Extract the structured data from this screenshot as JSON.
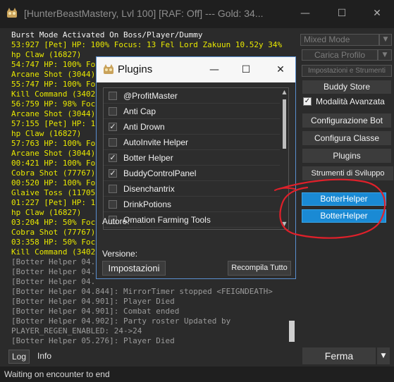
{
  "window": {
    "title": "[HunterBeastMastery, Lvl 100] [RAF: Off] --- Gold: 34...",
    "minimize": "—",
    "maximize": "☐",
    "close": "✕"
  },
  "console": {
    "lines": [
      {
        "text": "Burst Mode Activated On Boss/Player/Dummy",
        "cls": "w"
      },
      {
        "text": "53:927 [Pet] HP: 100% Focus: 13 Fel Lord Zakuun 10.52y 34%",
        "cls": "y"
      },
      {
        "text": "hp Claw (16827)",
        "cls": "y"
      },
      {
        "text": "54:747 HP: 100% Fo",
        "cls": "y"
      },
      {
        "text": "Arcane Shot (3044)",
        "cls": "y"
      },
      {
        "text": "55:747 HP: 100% Fo",
        "cls": "y"
      },
      {
        "text": "Kill Command (3402",
        "cls": "y"
      },
      {
        "text": "56:759 HP: 98% Foc",
        "cls": "y"
      },
      {
        "text": "Arcane Shot (3044)",
        "cls": "y"
      },
      {
        "text": "57:155 [Pet] HP: 1",
        "cls": "y"
      },
      {
        "text": "hp Claw (16827)",
        "cls": "y"
      },
      {
        "text": "57:763 HP: 100% Fo",
        "cls": "y"
      },
      {
        "text": "Arcane Shot (3044)",
        "cls": "y"
      },
      {
        "text": "00:421 HP: 100% Fo",
        "cls": "y"
      },
      {
        "text": "Cobra Shot (77767)",
        "cls": "y"
      },
      {
        "text": "00:520 HP: 100% Fo",
        "cls": "y"
      },
      {
        "text": "Glaive Toss (11705",
        "cls": "y"
      },
      {
        "text": "01:227 [Pet] HP: 1",
        "cls": "y"
      },
      {
        "text": "hp Claw (16827)",
        "cls": "y"
      },
      {
        "text": "03:204 HP: 50% Foc",
        "cls": "y"
      },
      {
        "text": "Cobra Shot (77767)",
        "cls": "y"
      },
      {
        "text": "03:358 HP: 50% Foc",
        "cls": "y"
      },
      {
        "text": "Kill Command (3402",
        "cls": "y"
      },
      {
        "text": "[Botter Helper 04.",
        "cls": "g"
      },
      {
        "text": "[Botter Helper 04.",
        "cls": "g"
      },
      {
        "text": "[Botter Helper 04.",
        "cls": "g"
      },
      {
        "text": "[Botter Helper 04.844]: MirrorTimer stopped <FEIGNDEATH>",
        "cls": "g"
      },
      {
        "text": "[Botter Helper 04.901]: Player Died",
        "cls": "g"
      },
      {
        "text": "[Botter Helper 04.901]: Combat ended",
        "cls": "g"
      },
      {
        "text": "[Botter Helper 04.902]: Party roster Updated by",
        "cls": "g"
      },
      {
        "text": "PLAYER_REGEN_ENABLED: 24->24",
        "cls": "g"
      },
      {
        "text": "[Botter Helper 05.276]: Player Died",
        "cls": "g"
      }
    ]
  },
  "right_panel": {
    "mode_select": "Mixed Mode",
    "profile_button": "Carica Profilo",
    "settings_tools_button": "Impostazioni e Strumenti",
    "buddy_store": "Buddy Store",
    "advanced_mode_label": "Modalità Avanzata",
    "bot_config": "Configurazione Bot",
    "class_config": "Configura Classe",
    "plugins": "Plugins",
    "dev_tools": "Strumenti di Sviluppo",
    "botterhelper_1": "BotterHelper",
    "botterhelper_2": "BotterHelper",
    "stop_button": "Ferma"
  },
  "plugins_dialog": {
    "title": "Plugins",
    "items": [
      {
        "label": "@ProfitMaster",
        "checked": false
      },
      {
        "label": "Anti Cap",
        "checked": false
      },
      {
        "label": "Anti Drown",
        "checked": true
      },
      {
        "label": "AutoInvite Helper",
        "checked": false
      },
      {
        "label": "Botter Helper",
        "checked": true
      },
      {
        "label": "BuddyControlPanel",
        "checked": true
      },
      {
        "label": "Disenchantrix",
        "checked": false
      },
      {
        "label": "DrinkPotions",
        "checked": false
      },
      {
        "label": "Omation Farming Tools",
        "checked": false
      }
    ],
    "author_label": "Autore:",
    "version_label": "Versione:",
    "settings_button": "Impostazioni",
    "recompile_button": "Recompila Tutto"
  },
  "tabs": {
    "log": "Log",
    "info": "Info"
  },
  "status": {
    "text": "Waiting on encounter to end"
  },
  "colors": {
    "annotation": "#e0202a",
    "accent_blue": "#1a8ad4",
    "log_yellow": "#e8e800"
  }
}
